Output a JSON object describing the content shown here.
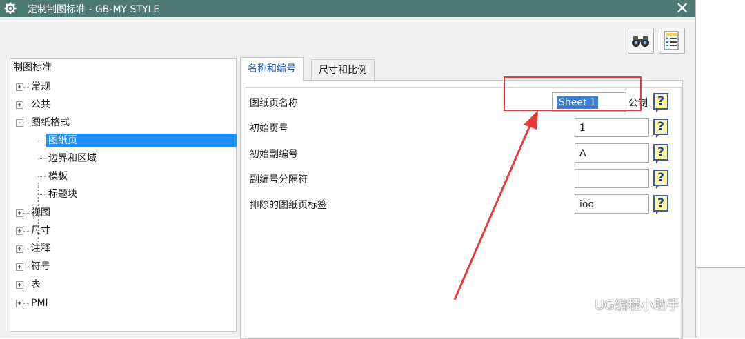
{
  "window": {
    "title": "定制制图标准 - GB-MY STYLE",
    "close_glyph": "✕"
  },
  "toolbar": {
    "buttons": [
      "binoculars-icon",
      "properties-list-icon"
    ]
  },
  "tree": {
    "header": "制图标准",
    "items": [
      {
        "label": "常规",
        "expander": "+"
      },
      {
        "label": "公共",
        "expander": "+"
      },
      {
        "label": "图纸格式",
        "expander": "-"
      },
      {
        "label": "图纸页"
      },
      {
        "label": "边界和区域"
      },
      {
        "label": "模板"
      },
      {
        "label": "标题块"
      },
      {
        "label": "视图",
        "expander": "+"
      },
      {
        "label": "尺寸",
        "expander": "+"
      },
      {
        "label": "注释",
        "expander": "+"
      },
      {
        "label": "符号",
        "expander": "+"
      },
      {
        "label": "表",
        "expander": "+"
      },
      {
        "label": "PMI",
        "expander": "+"
      }
    ],
    "selected": "图纸页"
  },
  "tabs": [
    {
      "label": "名称和编号",
      "active": true
    },
    {
      "label": "尺寸和比例",
      "active": false
    }
  ],
  "form": {
    "sheet_name_label": "图纸页名称",
    "sheet_name_value": "Sheet 1",
    "sheet_name_unit": "公制",
    "start_page_label": "初始页号",
    "start_page_value": "1",
    "start_sub_label": "初始副编号",
    "start_sub_value": "A",
    "separator_label": "副编号分隔符",
    "separator_value": "",
    "excluded_label": "排除的图纸页标签",
    "excluded_value": "ioq",
    "help_glyph": "?"
  },
  "annotation": {
    "highlight_color": "#e63b3b"
  },
  "watermark": {
    "text": "UG编程小助手"
  },
  "colors": {
    "titlebar": "#4f7a72",
    "selection": "#1e90ff",
    "help_bg": "#fff9a8"
  }
}
